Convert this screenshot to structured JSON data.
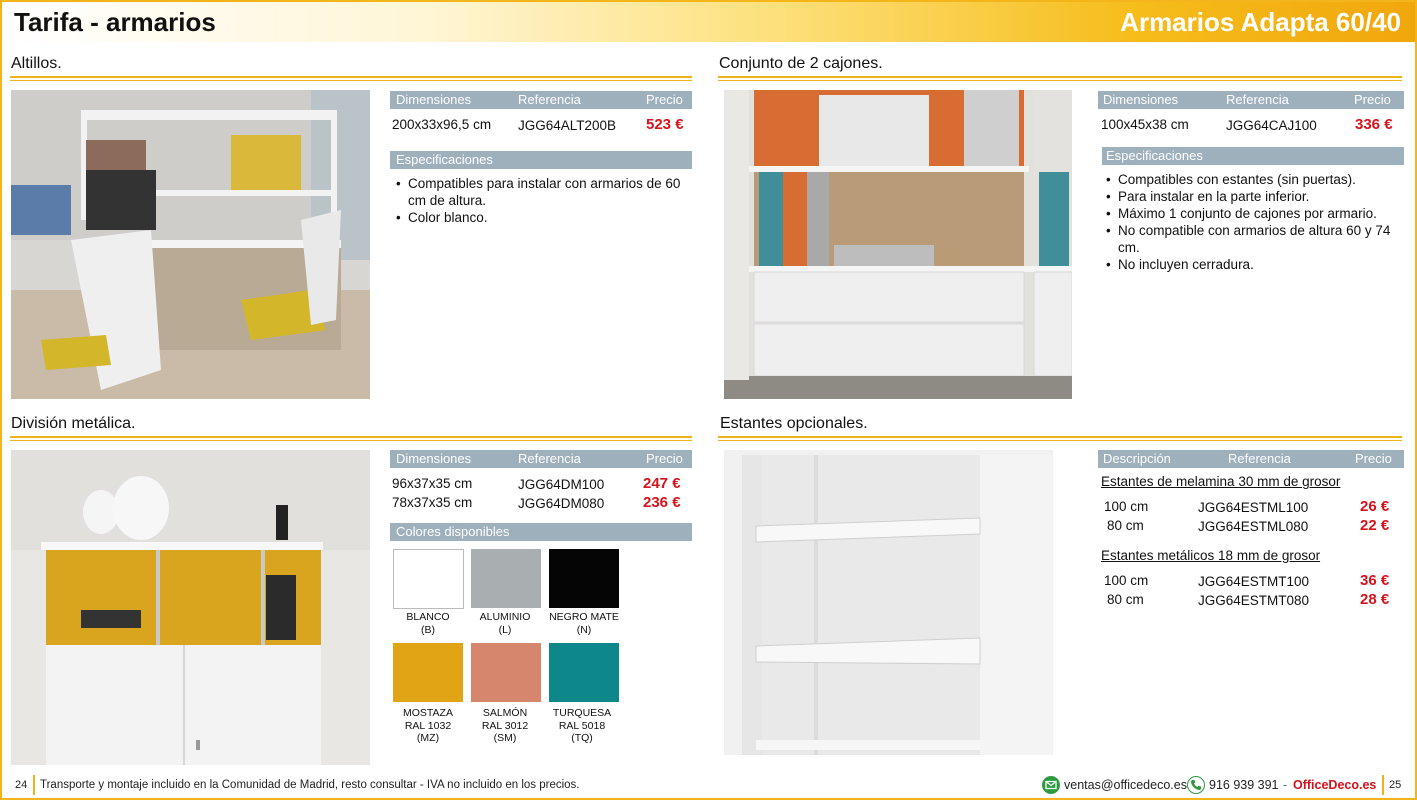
{
  "header": {
    "left_title": "Tarifa - armarios",
    "right_title": "Armarios Adapta 60/40"
  },
  "sections": {
    "altillos": {
      "title": "Altillos.",
      "table": {
        "headers": [
          "Dimensiones",
          "Referencia",
          "Precio"
        ],
        "row": {
          "dimensiones": "200x33x96,5 cm",
          "referencia": "JGG64ALT200B",
          "precio": "523 €"
        }
      },
      "spec_title": "Especificaciones",
      "specs": [
        "Compatibles para instalar con armarios de 60 cm de altura.",
        "Color blanco."
      ]
    },
    "cajones": {
      "title": "Conjunto de 2 cajones.",
      "table": {
        "headers": [
          "Dimensiones",
          "Referencia",
          "Precio"
        ],
        "row": {
          "dimensiones": "100x45x38 cm",
          "referencia": "JGG64CAJ100",
          "precio": "336 €"
        }
      },
      "spec_title": "Especificaciones",
      "specs": [
        "Compatibles con estantes (sin puertas).",
        "Para instalar en la parte inferior.",
        "Máximo 1 conjunto de cajones por armario.",
        "No compatible con armarios de altura 60 y 74 cm.",
        "No incluyen cerradura."
      ]
    },
    "division": {
      "title": "División metálica.",
      "table": {
        "headers": [
          "Dimensiones",
          "Referencia",
          "Precio"
        ],
        "rows": [
          {
            "dimensiones": "96x37x35 cm",
            "referencia": "JGG64DM100",
            "precio": "247 €"
          },
          {
            "dimensiones": "78x37x35 cm",
            "referencia": "JGG64DM080",
            "precio": "236 €"
          }
        ]
      },
      "colors_title": "Colores disponibles",
      "colors": [
        {
          "line1": "BLANCO",
          "line2": "(B)",
          "line3": "",
          "hex": "#ffffff"
        },
        {
          "line1": "ALUMINIO",
          "line2": "(L)",
          "line3": "",
          "hex": "#a9aeb0"
        },
        {
          "line1": "NEGRO MATE",
          "line2": "(N)",
          "line3": "",
          "hex": "#050505"
        },
        {
          "line1": "MOSTAZA",
          "line2": "RAL 1032",
          "line3": "(MZ)",
          "hex": "#e0a415"
        },
        {
          "line1": "SALMÓN",
          "line2": "RAL 3012",
          "line3": "(SM)",
          "hex": "#d6866c"
        },
        {
          "line1": "TURQUESA",
          "line2": "RAL 5018",
          "line3": "(TQ)",
          "hex": "#0e878b"
        }
      ]
    },
    "estantes": {
      "title": "Estantes opcionales.",
      "table": {
        "headers": [
          "Descripción",
          "Referencia",
          "Precio"
        ]
      },
      "groups": [
        {
          "title": "Estantes de melamina 30 mm de grosor",
          "rows": [
            {
              "medida": "100 cm",
              "referencia": "JGG64ESTML100",
              "precio": "26 €"
            },
            {
              "medida": "80 cm",
              "referencia": "JGG64ESTML080",
              "precio": "22 €"
            }
          ]
        },
        {
          "title": "Estantes metálicos 18 mm de grosor",
          "rows": [
            {
              "medida": "100 cm",
              "referencia": "JGG64ESTMT100",
              "precio": "36 €"
            },
            {
              "medida": "80 cm",
              "referencia": "JGG64ESTMT080",
              "precio": "28 €"
            }
          ]
        }
      ]
    }
  },
  "footer": {
    "page_left": "24",
    "page_right": "25",
    "text": "Transporte y montaje incluido en la Comunidad de Madrid, resto consultar - IVA no incluido en los precios.",
    "email": "ventas@officedeco.es",
    "phone": "916 939 391",
    "brand": "OfficeDeco.es",
    "separator": "-"
  },
  "colors": {
    "accent": "#f0b21e",
    "table_header": "#9fb0bd",
    "price": "#d6121b"
  }
}
